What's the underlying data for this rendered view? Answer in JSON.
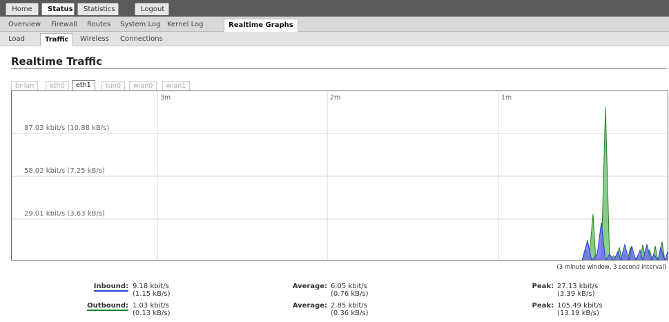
{
  "top_menu": [
    {
      "label": "Home",
      "active": false
    },
    {
      "label": "Status",
      "active": true
    },
    {
      "label": "Statistics",
      "active": false
    },
    {
      "label": "Logout",
      "active": false
    }
  ],
  "sub_menu": [
    {
      "label": "Overview",
      "active": false
    },
    {
      "label": "Firewall",
      "active": false
    },
    {
      "label": "Routes",
      "active": false
    },
    {
      "label": "System Log",
      "active": false
    },
    {
      "label": "Kernel Log",
      "active": false
    },
    {
      "label": "Realtime Graphs",
      "active": true
    }
  ],
  "sub_sub_menu": [
    {
      "label": "Load",
      "active": false
    },
    {
      "label": "Traffic",
      "active": true
    },
    {
      "label": "Wireless",
      "active": false
    },
    {
      "label": "Connections",
      "active": false
    }
  ],
  "page_title": "Realtime Traffic",
  "interfaces": [
    {
      "label": "br-lan",
      "active": false
    },
    {
      "label": "eth0",
      "active": false
    },
    {
      "label": "eth1",
      "active": true
    },
    {
      "label": "tun0",
      "active": false
    },
    {
      "label": "wlan0",
      "active": false
    },
    {
      "label": "wlan1",
      "active": false
    }
  ],
  "graph": {
    "y_labels": [
      "87.03 kbit/s (10.88 kB/s)",
      "58.02 kbit/s (7.25 kB/s)",
      "29.01 kbit/s (3.63 kB/s)"
    ],
    "x_labels": [
      "3m",
      "2m",
      "1m"
    ],
    "window_note": "(3 minute window, 3 second interval)",
    "colors": {
      "inbound": "#2040d0",
      "outbound": "#208020"
    }
  },
  "stats": {
    "inbound_label": "Inbound:",
    "inbound_kbit": "9.18 kbit/s",
    "inbound_kb": "(1.15 kB/s)",
    "inbound_avg_label": "Average:",
    "inbound_avg_kbit": "6.05 kbit/s",
    "inbound_avg_kb": "(0.76 kB/s)",
    "inbound_peak_label": "Peak:",
    "inbound_peak_kbit": "27.13 kbit/s",
    "inbound_peak_kb": "(3.39 kB/s)",
    "outbound_label": "Outbound:",
    "outbound_kbit": "1.03 kbit/s",
    "outbound_kb": "(0.13 kB/s)",
    "outbound_avg_label": "Average:",
    "outbound_avg_kbit": "2.85 kbit/s",
    "outbound_avg_kb": "(0.36 kB/s)",
    "outbound_peak_label": "Peak:",
    "outbound_peak_kbit": "105.49 kbit/s",
    "outbound_peak_kb": "(13.19 kB/s)"
  }
}
